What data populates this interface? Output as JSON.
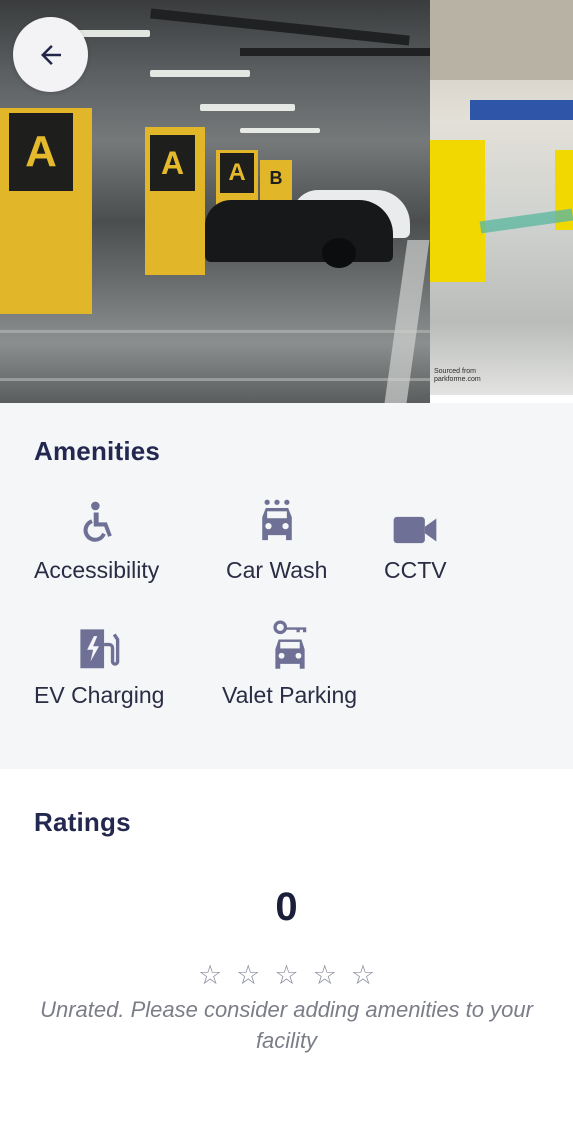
{
  "navigation": {
    "back_button_label": "Back"
  },
  "hero": {
    "pillar_signs": [
      "A",
      "A",
      "A",
      "B"
    ],
    "watermark_line1": "Sourced from",
    "watermark_line2": "parkforme.com"
  },
  "amenities": {
    "title": "Amenities",
    "items": [
      {
        "label": "Accessibility",
        "icon": "wheelchair-icon"
      },
      {
        "label": "Car Wash",
        "icon": "car-wash-icon"
      },
      {
        "label": "CCTV",
        "icon": "video-camera-icon"
      },
      {
        "label": "EV Charging",
        "icon": "ev-charging-icon"
      },
      {
        "label": "Valet Parking",
        "icon": "valet-key-car-icon"
      }
    ]
  },
  "ratings": {
    "title": "Ratings",
    "value": "0",
    "stars_filled": 0,
    "stars_total": 5,
    "note": "Unrated. Please consider adding amenities to your facility"
  },
  "colors": {
    "primary_text": "#232851",
    "icon": "#6e7195",
    "muted_text": "#7b7e87",
    "pillar_yellow": "#e1b629"
  }
}
